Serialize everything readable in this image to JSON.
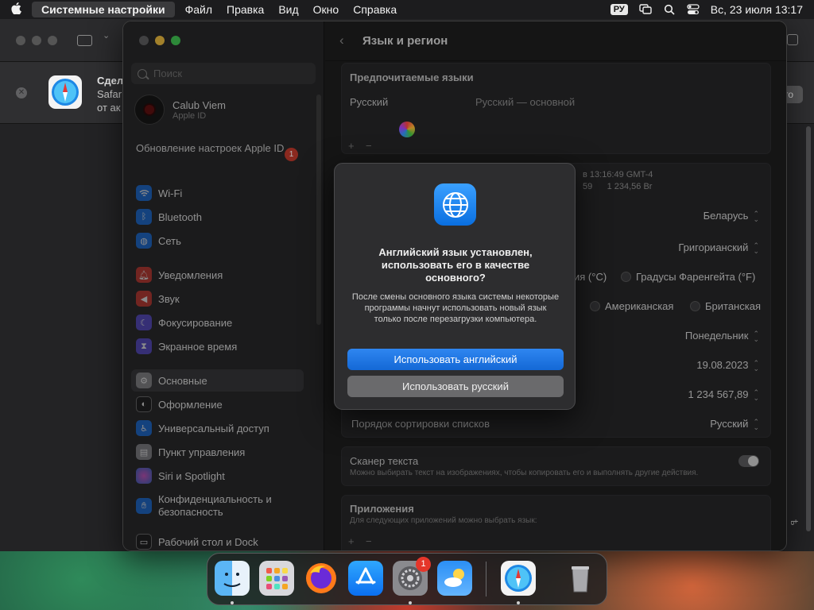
{
  "menubar": {
    "app_name": "Системные настройки",
    "items": [
      "Файл",
      "Правка",
      "Вид",
      "Окно",
      "Справка"
    ],
    "input_lang": "РУ",
    "datetime": "Вс, 23 июля  13:17"
  },
  "background_window": {
    "notice_title": "Сдел",
    "notice_line2": "Safar",
    "notice_line3": "от ак",
    "right_button": "то",
    "vertical_text": "ѣ"
  },
  "sidebar": {
    "search_placeholder": "Поиск",
    "account": {
      "name": "Calub Viem",
      "subtitle": "Apple ID"
    },
    "update_notice": "Обновление настроек Apple ID",
    "update_badge": "1",
    "items": [
      {
        "label": "Wi-Fi",
        "icon": "wifi-icon",
        "color": "#1a73e8"
      },
      {
        "label": "Bluetooth",
        "icon": "bluetooth-icon",
        "color": "#1a73e8"
      },
      {
        "label": "Сеть",
        "icon": "network-globe-icon",
        "color": "#1a73e8"
      },
      {
        "label": "Уведомления",
        "icon": "bell-icon",
        "color": "#d33a32"
      },
      {
        "label": "Звук",
        "icon": "speaker-icon",
        "color": "#d33a32"
      },
      {
        "label": "Фокусирование",
        "icon": "moon-icon",
        "color": "#5b4fd6"
      },
      {
        "label": "Экранное время",
        "icon": "hourglass-icon",
        "color": "#5b4fd6"
      },
      {
        "label": "Основные",
        "icon": "gear-icon",
        "color": "#8e8e93"
      },
      {
        "label": "Оформление",
        "icon": "appearance-icon",
        "color": "#1c1c1c"
      },
      {
        "label": "Универсальный доступ",
        "icon": "accessibility-icon",
        "color": "#1a73e8"
      },
      {
        "label": "Пункт управления",
        "icon": "control-center-icon",
        "color": "#8e8e93"
      },
      {
        "label": "Siri и Spotlight",
        "icon": "siri-icon",
        "color": "#b03ad6"
      },
      {
        "label": "Конфиденциальность и безопасность",
        "icon": "hand-icon",
        "color": "#1a73e8"
      },
      {
        "label": "Рабочий стол и Dock",
        "icon": "dock-icon",
        "color": "#1c1c1c"
      }
    ]
  },
  "content": {
    "title": "Язык и регион",
    "preferred_languages_header": "Предпочитаемые языки",
    "language": "Русский",
    "language_desc": "Русский — основной",
    "add": "+",
    "remove": "−",
    "preview_time": "в 13:16:49 GMT-4",
    "preview_nums": "59      1 234,56 Br",
    "region": "Беларусь",
    "calendar": "Григорианский",
    "temp_celsius": "ия (°C)",
    "temp_fahrenheit": "Градусы Фаренгейта (°F)",
    "measure_us": "Американская",
    "measure_uk": "Британская",
    "first_day": "Понедельник",
    "date_format": "19.08.2023",
    "number_format": "1 234 567,89",
    "sort_label": "Порядок сортировки списков",
    "sort_value": "Русский",
    "scanner_title": "Сканер текста",
    "scanner_desc": "Можно выбирать текст на изображениях, чтобы копировать его и выполнять другие действия.",
    "apps_title": "Приложения",
    "apps_desc": "Для следующих приложений можно выбрать язык:"
  },
  "dialog": {
    "title": "Английский язык установлен, использовать его в качестве основного?",
    "body": "После смены основного языка системы некоторые программы начнут использовать новый язык только после перезагрузки компьютера.",
    "primary_button": "Использовать английский",
    "secondary_button": "Использовать русский"
  },
  "dock": {
    "apps": [
      "finder-icon",
      "launchpad-icon",
      "firefox-icon",
      "app-store-icon",
      "system-settings-icon",
      "weather-icon",
      "safari-icon",
      "trash-icon"
    ],
    "settings_badge": "1"
  }
}
